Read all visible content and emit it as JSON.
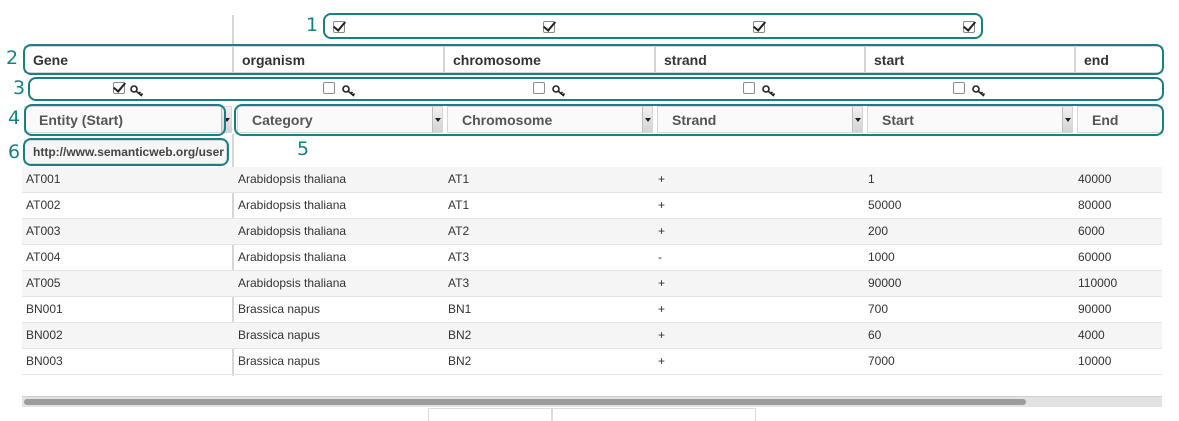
{
  "callouts": [
    "1",
    "2",
    "3",
    "4",
    "5",
    "6"
  ],
  "header_cells": [
    "Gene",
    "organism",
    "chromosome",
    "strand",
    "start",
    "end"
  ],
  "include_checkboxes": [
    true,
    true,
    true,
    true
  ],
  "key_checkboxes": [
    true,
    false,
    false,
    false,
    false
  ],
  "type_selects": [
    "Entity (Start)",
    "Category",
    "Chromosome",
    "Strand",
    "Start",
    "End"
  ],
  "entity_uri": "http://www.semanticweb.org/user",
  "rows": [
    [
      "AT001",
      "Arabidopsis thaliana",
      "AT1",
      "+",
      "1",
      "40000"
    ],
    [
      "AT002",
      "Arabidopsis thaliana",
      "AT1",
      "+",
      "50000",
      "80000"
    ],
    [
      "AT003",
      "Arabidopsis thaliana",
      "AT2",
      "+",
      "200",
      "6000"
    ],
    [
      "AT004",
      "Arabidopsis thaliana",
      "AT3",
      "-",
      "1000",
      "60000"
    ],
    [
      "AT005",
      "Arabidopsis thaliana",
      "AT3",
      "+",
      "90000",
      "110000"
    ],
    [
      "BN001",
      "Brassica napus",
      "BN1",
      "+",
      "700",
      "90000"
    ],
    [
      "BN002",
      "Brassica napus",
      "BN2",
      "+",
      "60",
      "4000"
    ],
    [
      "BN003",
      "Brassica napus",
      "BN2",
      "+",
      "7000",
      "10000"
    ]
  ],
  "colors": {
    "annotation": "#1a7f80",
    "row_alt": "#f5f5f5",
    "border": "#d5d5d5"
  },
  "icons": {
    "key": "key-icon",
    "dropdown": "chevron-down-icon",
    "checkbox": "checkbox-icon"
  }
}
